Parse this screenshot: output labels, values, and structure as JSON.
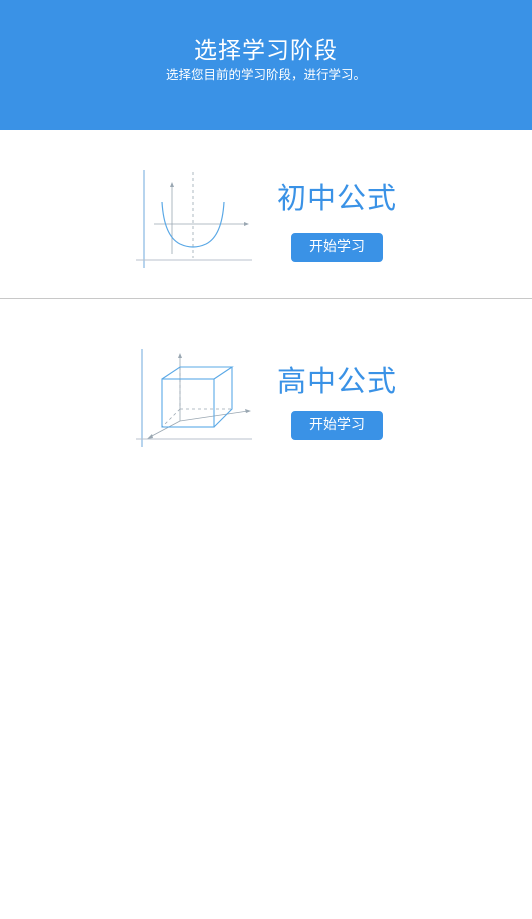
{
  "header": {
    "title": "选择学习阶段",
    "subtitle": "选择您目前的学习阶段，进行学习。"
  },
  "stages": [
    {
      "title": "初中公式",
      "button_label": "开始学习",
      "illustration_icon": "parabola-graph-icon"
    },
    {
      "title": "高中公式",
      "button_label": "开始学习",
      "illustration_icon": "3d-cube-axes-icon"
    }
  ],
  "colors": {
    "accent": "#3a92e6",
    "line": "#c8c8c8",
    "illustration_stroke": "#5aa8e6",
    "illustration_axes": "#9aa7b2"
  }
}
